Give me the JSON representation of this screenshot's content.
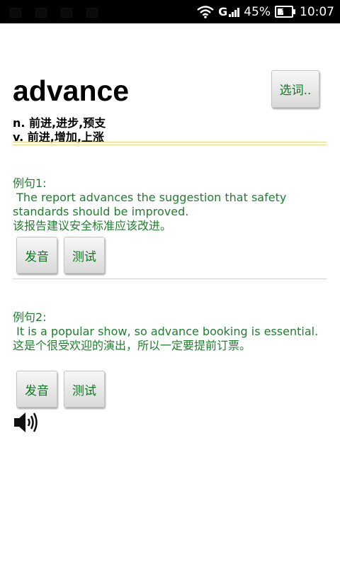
{
  "status_bar": {
    "signal_type": "G",
    "battery_percent": "45%",
    "time": "10:07",
    "battery_level": 0.45,
    "icons": [
      "wifi-icon",
      "signal-icon",
      "battery-charging-icon"
    ]
  },
  "word": {
    "headword": "advance",
    "pick_button_label": "选词..",
    "definitions": [
      "n. 前进,进步,预支",
      "v. 前进,增加,上涨"
    ]
  },
  "examples": [
    {
      "label": "例句1:",
      "english": " The report advances the suggestion that safety standards should be improved.",
      "chinese": "该报告建议安全标准应该改进。",
      "pronounce_label": "发音",
      "test_label": "测试"
    },
    {
      "label": "例句2:",
      "english": " It is a popular show, so advance booking is essential.",
      "chinese": "这是个很受欢迎的演出，所以一定要提前订票。",
      "pronounce_label": "发音",
      "test_label": "测试"
    }
  ],
  "colors": {
    "example_text": "#1f7f2e",
    "button_text": "#0b7a1e",
    "divider": "#f1d27a"
  },
  "speaker_icon": "speaker-volume-icon"
}
